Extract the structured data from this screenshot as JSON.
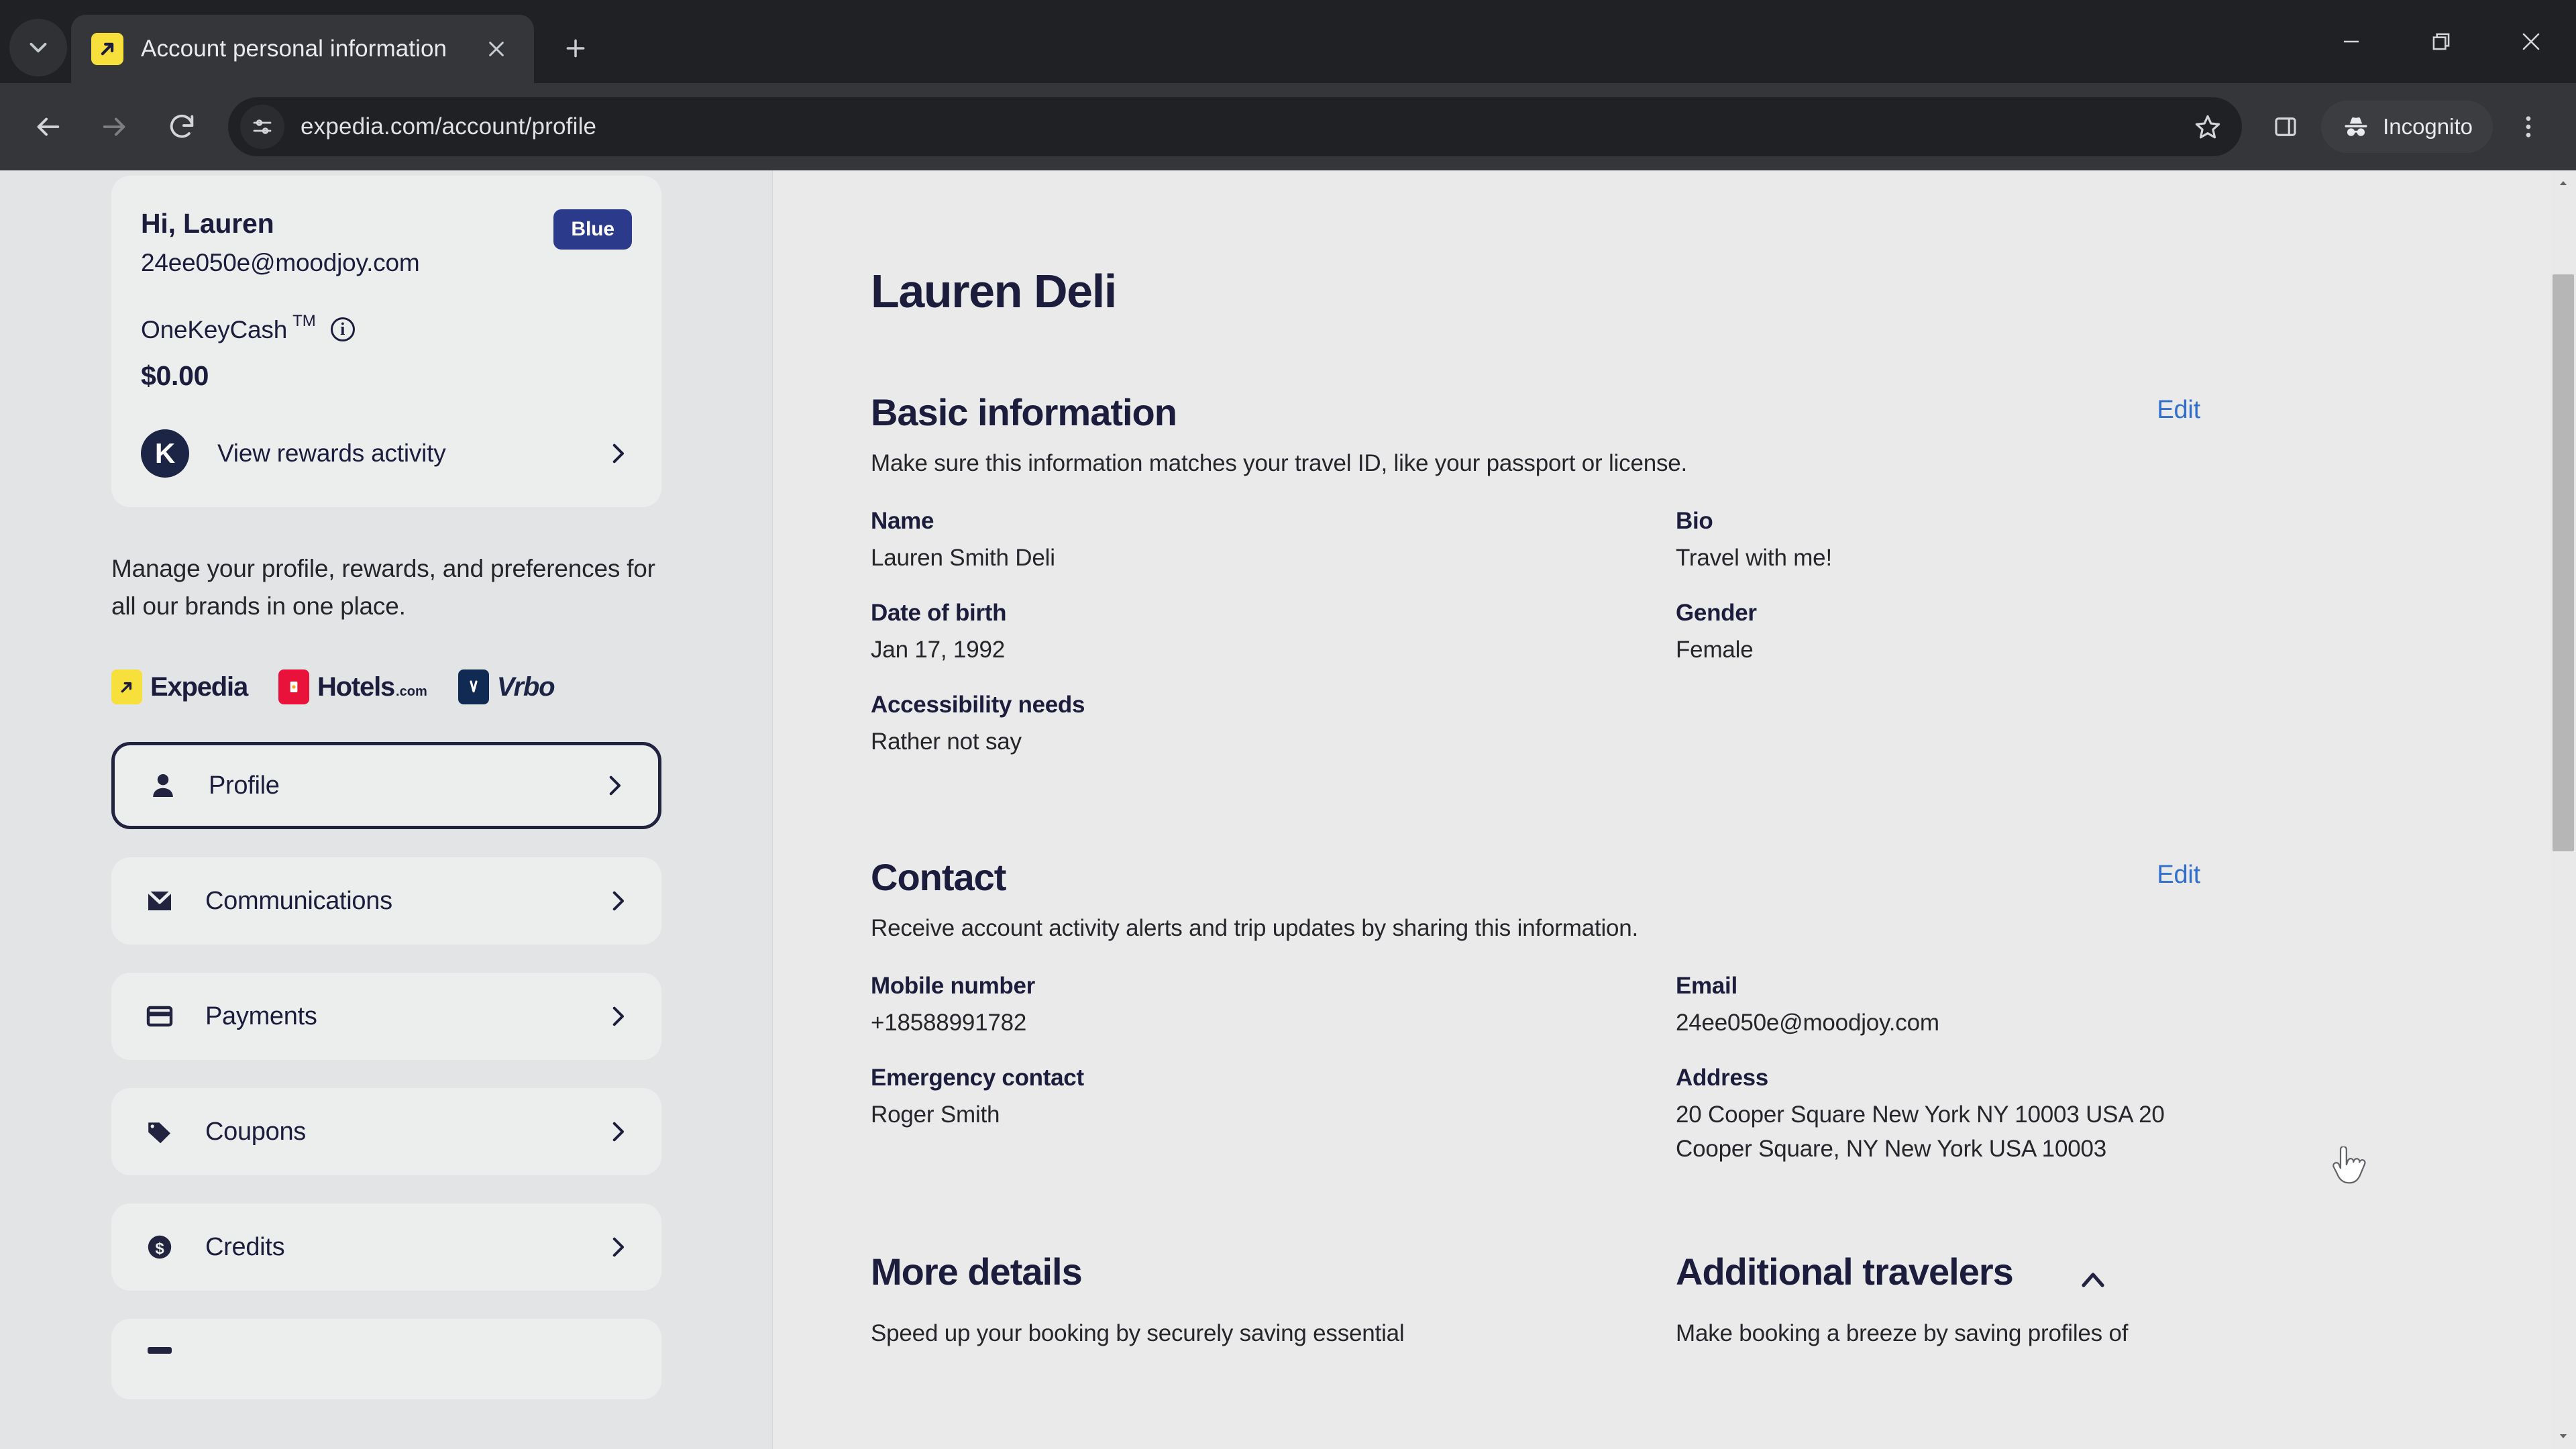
{
  "browser": {
    "tab": {
      "title": "Account personal information",
      "favicon": "expedia-favicon",
      "close_label": "Close tab"
    },
    "new_tab_label": "New Tab",
    "tab_search_label": "Search tabs",
    "window": {
      "minimize": "Minimize",
      "maximize": "Restore",
      "close": "Close"
    },
    "toolbar": {
      "back": "Back",
      "forward": "Forward",
      "reload": "Reload",
      "url": "expedia.com/account/profile",
      "bookmark": "Bookmark this tab",
      "side_panel": "Side panel",
      "profile_label": "Incognito",
      "menu": "Customize and control Google Chrome"
    }
  },
  "sidebar": {
    "account": {
      "greeting": "Hi, Lauren",
      "email": "24ee050e@moodjoy.com",
      "tier_badge": "Blue",
      "rewards_label": "OneKeyCash",
      "rewards_tm": "TM",
      "rewards_info": "i",
      "rewards_amount": "$0.00",
      "rewards_link": "View rewards activity",
      "rewards_logo": "K"
    },
    "blurb": "Manage your profile, rewards, and preferences for all our brands in one place.",
    "brands": [
      {
        "name": "Expedia",
        "sub": "",
        "mark": "expedia-mark"
      },
      {
        "name": "Hotels",
        "sub": ".com",
        "mark": "hotels-mark"
      },
      {
        "name": "Vrbo",
        "sub": "",
        "mark": "vrbo-mark"
      }
    ],
    "nav": [
      {
        "label": "Profile",
        "icon": "person-icon",
        "active": true
      },
      {
        "label": "Communications",
        "icon": "envelope-icon",
        "active": false
      },
      {
        "label": "Payments",
        "icon": "credit-card-icon",
        "active": false
      },
      {
        "label": "Coupons",
        "icon": "tag-icon",
        "active": false
      },
      {
        "label": "Credits",
        "icon": "dollar-coin-icon",
        "active": false
      }
    ]
  },
  "main": {
    "page_title": "Lauren Deli",
    "basic": {
      "title": "Basic information",
      "edit_label": "Edit",
      "description": "Make sure this information matches your travel ID, like your passport or license.",
      "fields_left": [
        {
          "label": "Name",
          "value": "Lauren Smith Deli"
        },
        {
          "label": "Date of birth",
          "value": "Jan 17, 1992"
        },
        {
          "label": "Accessibility needs",
          "value": "Rather not say"
        }
      ],
      "fields_right": [
        {
          "label": "Bio",
          "value": "Travel with me!"
        },
        {
          "label": "Gender",
          "value": "Female"
        }
      ]
    },
    "contact": {
      "title": "Contact",
      "edit_label": "Edit",
      "description": "Receive account activity alerts and trip updates by sharing this information.",
      "fields_left": [
        {
          "label": "Mobile number",
          "value": "+18588991782"
        },
        {
          "label": "Emergency contact",
          "value": "Roger Smith"
        }
      ],
      "fields_right": [
        {
          "label": "Email",
          "value": "24ee050e@moodjoy.com"
        },
        {
          "label": "Address",
          "value": "20 Cooper Square New York NY 10003 USA 20 Cooper Square, NY New York USA 10003"
        }
      ]
    },
    "more_details": {
      "title": "More details",
      "description": "Speed up your booking by securely saving essential"
    },
    "additional_travelers": {
      "title": "Additional travelers",
      "description": "Make booking a breeze by saving profiles of",
      "collapse_icon": "chevron-up-icon"
    }
  },
  "colors": {
    "accent_link": "#2f6ecc",
    "brand_navy": "#1c1c3c",
    "tier_badge_bg": "#2c3a8c",
    "page_bg": "#eaeaea",
    "sidebar_bg": "#e3e4e6"
  }
}
